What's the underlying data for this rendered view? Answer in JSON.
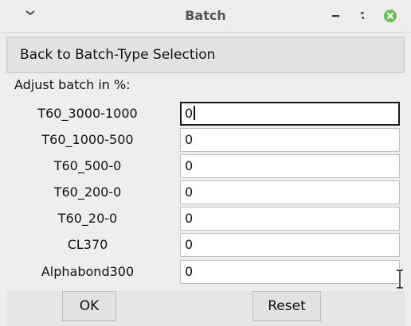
{
  "window": {
    "title": "Batch",
    "menu_icon": "chevron-down-icon",
    "minimize_icon": "minimize-icon",
    "restore_icon": "restore-icon",
    "close_icon": "close-icon",
    "close_color": "#5fb05f"
  },
  "back_button": {
    "label": "Back to Batch-Type Selection"
  },
  "adjust_label": "Adjust batch in %:",
  "fields": [
    {
      "label": "T60_3000-1000",
      "value": "0"
    },
    {
      "label": "T60_1000-500",
      "value": "0"
    },
    {
      "label": "T60_500-0",
      "value": "0"
    },
    {
      "label": "T60_200-0",
      "value": "0"
    },
    {
      "label": "T60_20-0",
      "value": "0"
    },
    {
      "label": "CL370",
      "value": "0"
    },
    {
      "label": "Alphabond300",
      "value": "0"
    }
  ],
  "buttons": {
    "ok_label": "OK",
    "reset_label": "Reset"
  }
}
